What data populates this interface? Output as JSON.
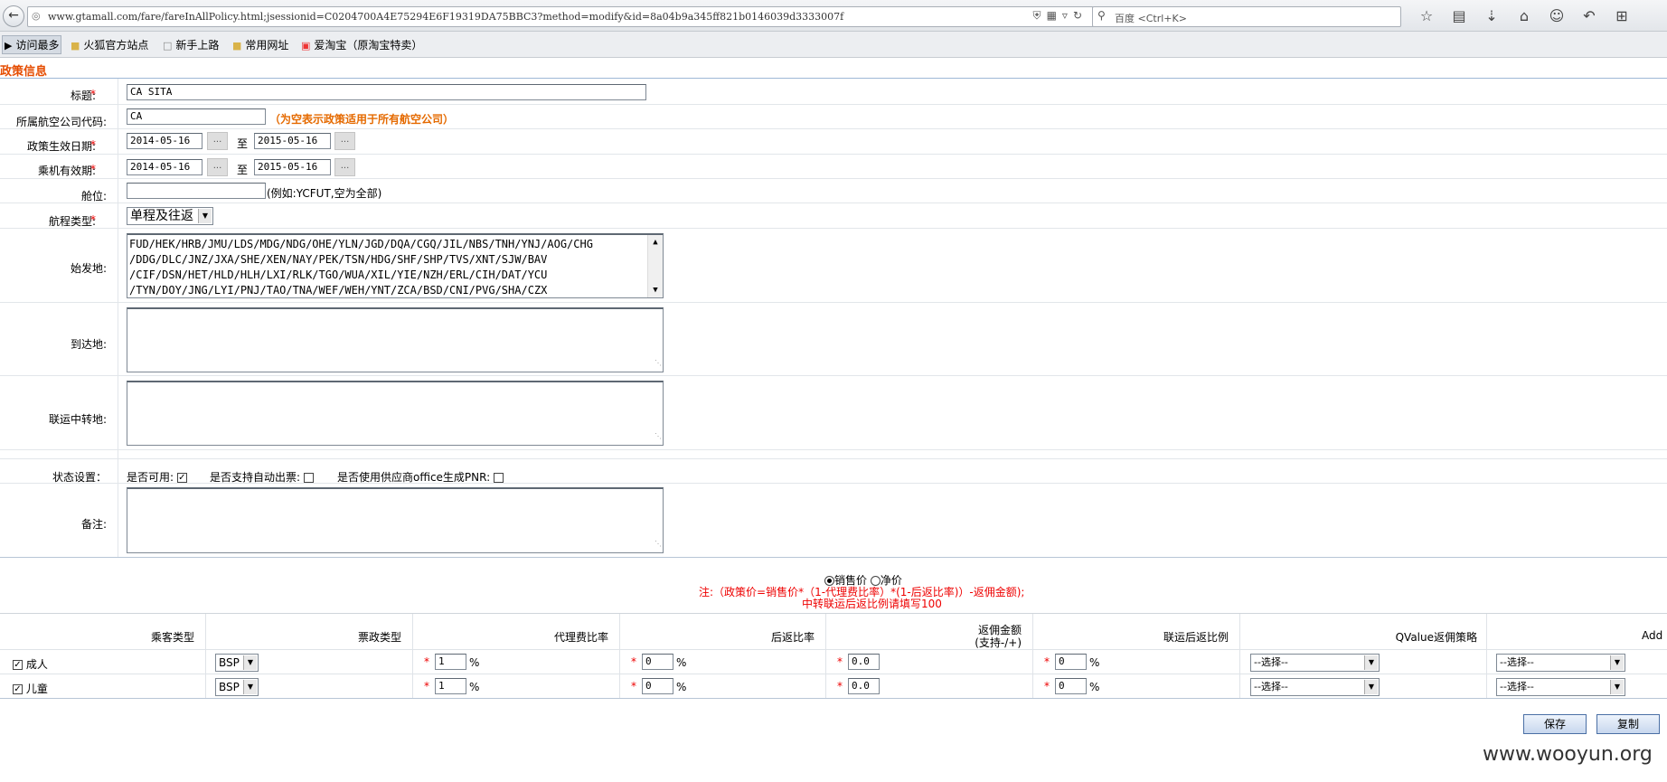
{
  "browser": {
    "url": "www.gtamall.com/fare/fareInAllPolicy.html;jsessionid=C0204700A4E75294E6F19319DA75BBC3?method=modify&id=8a04b9a345ff821b0146039d3333007f",
    "search_placeholder": "百度 <Ctrl+K>"
  },
  "bookmarks": [
    "访问最多",
    "火狐官方站点",
    "新手上路",
    "常用网址",
    "爱淘宝（原淘宝特卖）"
  ],
  "page_title": "政策信息",
  "form": {
    "title_label": "标题:",
    "title_value": "CA SITA",
    "airline_label": "所属航空公司代码:",
    "airline_value": "CA",
    "airline_hint": "（为空表示政策适用于所有航空公司）",
    "policy_date_label": "政策生效日期:",
    "policy_date_from": "2014-05-16",
    "policy_date_to": "2015-05-16",
    "ticket_date_label": "乘机有效期:",
    "ticket_date_from": "2014-05-16",
    "ticket_date_to": "2015-05-16",
    "to_text": "至",
    "date_btn": "...",
    "cabin_label": "舱位:",
    "cabin_value": "",
    "cabin_hint": "(例如:YCFUT,空为全部)",
    "route_type_label": "航程类型:",
    "route_type_value": "单程及往返",
    "origin_label": "始发地:",
    "origin_lines": [
      "FUD/HEK/HRB/JMU/LDS/MDG/NDG/OHE/YLN/JGD/DQA/CGQ/JIL/NBS/TNH/YNJ/AOG/CHG",
      "/DDG/DLC/JNZ/JXA/SHE/XEN/NAY/PEK/TSN/HDG/SHF/SHP/TVS/XNT/SJW/BAV",
      "/CIF/DSN/HET/HLD/HLH/LXI/RLK/TGO/WUA/XIL/YIE/NZH/ERL/CIH/DAT/YCU",
      "/TYN/DOY/JNG/LYI/PNJ/TAO/TNA/WEF/WEH/YNT/ZCA/BSD/CNI/PVG/SHA/CZX"
    ],
    "dest_label": "到达地:",
    "transit_label": "联运中转地:",
    "status_label": "状态设置：",
    "status_available": "是否可用:",
    "status_auto_ticket": "是否支持自动出票:",
    "status_supplier_pnr": "是否使用供应商office生成PNR:",
    "remark_label": "备注:"
  },
  "price_mode": {
    "sale_label": "销售价",
    "net_label": "净价"
  },
  "notes": [
    "注:（政策价=销售价*（1-代理费比率）*(1-后返比率)）-返佣金额);",
    "中转联运后返比例请填写100"
  ],
  "table": {
    "headers": [
      "乘客类型",
      "票政类型",
      "代理费比率",
      "后返比率",
      "返佣金额",
      "(支持-/+)",
      "联运后返比例",
      "QValue返佣策略",
      "Add"
    ],
    "rows": [
      {
        "type": "成人",
        "ticket": "BSP",
        "agent": "1",
        "back": "0",
        "rebate": "0.0",
        "union": "0",
        "q": "--选择--",
        "add": "--选择--"
      },
      {
        "type": "儿童",
        "ticket": "BSP",
        "agent": "1",
        "back": "0",
        "rebate": "0.0",
        "union": "0",
        "q": "--选择--",
        "add": "--选择--"
      }
    ],
    "pct": "%"
  },
  "buttons": {
    "save": "保存",
    "copy": "复制"
  },
  "watermark": "www.wooyun.org"
}
